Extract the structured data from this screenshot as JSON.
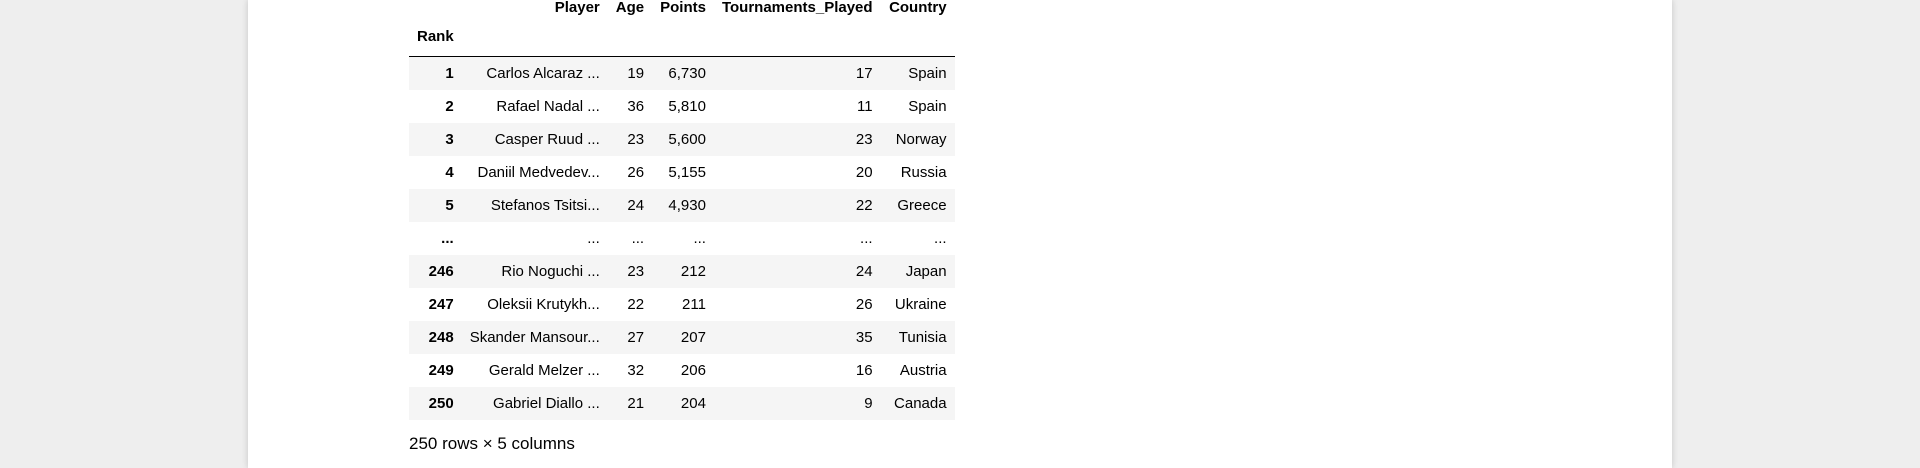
{
  "table": {
    "columns": [
      "Player",
      "Age",
      "Points",
      "Tournaments_Played",
      "Country"
    ],
    "index_name": "Rank",
    "rows": [
      {
        "rank": "1",
        "player": "Carlos Alcaraz ...",
        "age": "19",
        "points": "6,730",
        "tournaments": "17",
        "country": "Spain"
      },
      {
        "rank": "2",
        "player": "Rafael Nadal ...",
        "age": "36",
        "points": "5,810",
        "tournaments": "11",
        "country": "Spain"
      },
      {
        "rank": "3",
        "player": "Casper Ruud ...",
        "age": "23",
        "points": "5,600",
        "tournaments": "23",
        "country": "Norway"
      },
      {
        "rank": "4",
        "player": "Daniil Medvedev...",
        "age": "26",
        "points": "5,155",
        "tournaments": "20",
        "country": "Russia"
      },
      {
        "rank": "5",
        "player": "Stefanos Tsitsi...",
        "age": "24",
        "points": "4,930",
        "tournaments": "22",
        "country": "Greece"
      },
      {
        "rank": "...",
        "player": "...",
        "age": "...",
        "points": "...",
        "tournaments": "...",
        "country": "..."
      },
      {
        "rank": "246",
        "player": "Rio Noguchi ...",
        "age": "23",
        "points": "212",
        "tournaments": "24",
        "country": "Japan"
      },
      {
        "rank": "247",
        "player": "Oleksii Krutykh...",
        "age": "22",
        "points": "211",
        "tournaments": "26",
        "country": "Ukraine"
      },
      {
        "rank": "248",
        "player": "Skander Mansour...",
        "age": "27",
        "points": "207",
        "tournaments": "35",
        "country": "Tunisia"
      },
      {
        "rank": "249",
        "player": "Gerald Melzer ...",
        "age": "32",
        "points": "206",
        "tournaments": "16",
        "country": "Austria"
      },
      {
        "rank": "250",
        "player": "Gabriel Diallo ...",
        "age": "21",
        "points": "204",
        "tournaments": "9",
        "country": "Canada"
      }
    ]
  },
  "footer": "250 rows × 5 columns",
  "colors": {
    "page_background": "#eeeeee",
    "notebook_background": "#ffffff",
    "row_stripe": "#f5f5f5"
  }
}
